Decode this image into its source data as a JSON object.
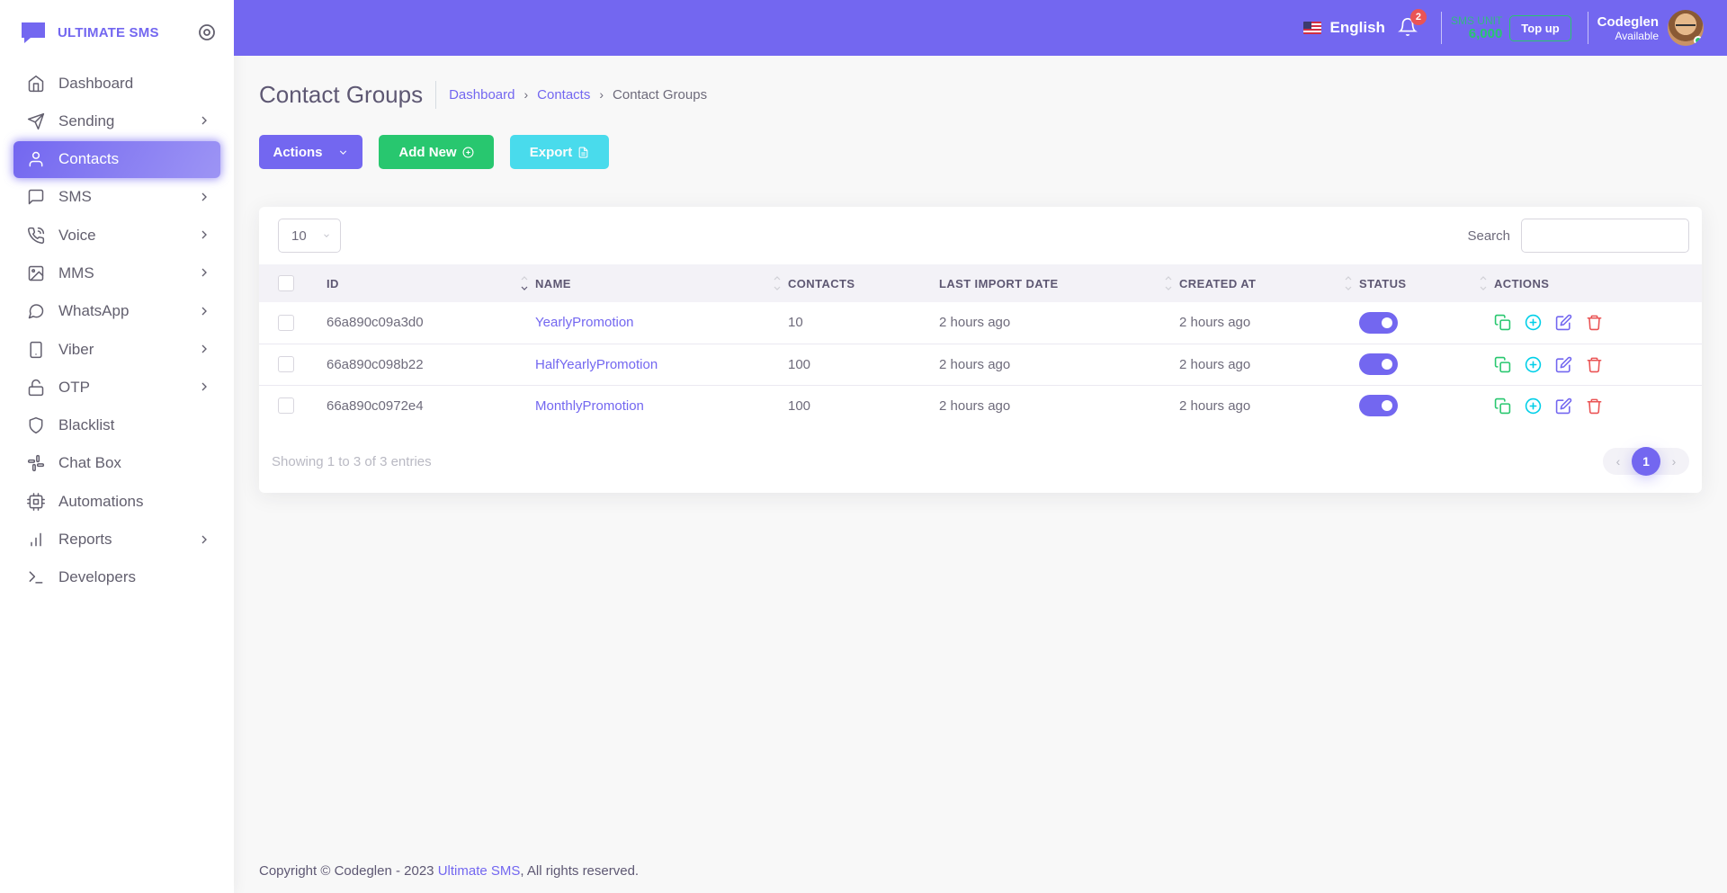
{
  "brand": {
    "name": "ULTIMATE SMS",
    "logo_icon": "chat-bubble-icon",
    "color": "#7367f0"
  },
  "sidebar": {
    "items": [
      {
        "label": "Dashboard",
        "icon": "home-icon",
        "has_children": false,
        "active": false
      },
      {
        "label": "Sending",
        "icon": "send-icon",
        "has_children": true,
        "active": false
      },
      {
        "label": "Contacts",
        "icon": "user-icon",
        "has_children": false,
        "active": true
      },
      {
        "label": "SMS",
        "icon": "message-square-icon",
        "has_children": true,
        "active": false
      },
      {
        "label": "Voice",
        "icon": "phone-call-icon",
        "has_children": true,
        "active": false
      },
      {
        "label": "MMS",
        "icon": "image-icon",
        "has_children": true,
        "active": false
      },
      {
        "label": "WhatsApp",
        "icon": "message-circle-icon",
        "has_children": true,
        "active": false
      },
      {
        "label": "Viber",
        "icon": "smartphone-icon",
        "has_children": true,
        "active": false
      },
      {
        "label": "OTP",
        "icon": "unlock-icon",
        "has_children": true,
        "active": false
      },
      {
        "label": "Blacklist",
        "icon": "shield-icon",
        "has_children": false,
        "active": false
      },
      {
        "label": "Chat Box",
        "icon": "slack-icon",
        "has_children": false,
        "active": false
      },
      {
        "label": "Automations",
        "icon": "cpu-icon",
        "has_children": false,
        "active": false
      },
      {
        "label": "Reports",
        "icon": "bar-chart-icon",
        "has_children": true,
        "active": false
      },
      {
        "label": "Developers",
        "icon": "terminal-icon",
        "has_children": false,
        "active": false
      }
    ]
  },
  "header": {
    "language": "English",
    "notifications_count": "2",
    "sms_unit_label": "SMS UNIT",
    "sms_unit_value": "6,000",
    "topup_label": "Top up",
    "user_name": "Codeglen",
    "user_status": "Available"
  },
  "page": {
    "title": "Contact Groups",
    "breadcrumb": [
      "Dashboard",
      "Contacts",
      "Contact Groups"
    ]
  },
  "toolbar": {
    "actions_label": "Actions",
    "add_new_label": "Add New",
    "export_label": "Export"
  },
  "table": {
    "page_length": "10",
    "search_label": "Search",
    "columns": [
      "ID",
      "NAME",
      "CONTACTS",
      "LAST IMPORT DATE",
      "CREATED AT",
      "STATUS",
      "ACTIONS"
    ],
    "rows": [
      {
        "id": "66a890c09a3d0",
        "name": "YearlyPromotion",
        "contacts": "10",
        "last_import": "2 hours ago",
        "created_at": "2 hours ago",
        "status": true
      },
      {
        "id": "66a890c098b22",
        "name": "HalfYearlyPromotion",
        "contacts": "100",
        "last_import": "2 hours ago",
        "created_at": "2 hours ago",
        "status": true
      },
      {
        "id": "66a890c0972e4",
        "name": "MonthlyPromotion",
        "contacts": "100",
        "last_import": "2 hours ago",
        "created_at": "2 hours ago",
        "status": true
      }
    ],
    "showing_text": "Showing 1 to 3 of 3 entries",
    "current_page": "1"
  },
  "footer": {
    "prefix": "Copyright © Codeglen - 2023",
    "link": "Ultimate SMS",
    "suffix": ", All rights reserved."
  },
  "colors": {
    "primary": "#7367f0",
    "success": "#28c76f",
    "info": "#00cfe8",
    "danger": "#ea5455"
  }
}
